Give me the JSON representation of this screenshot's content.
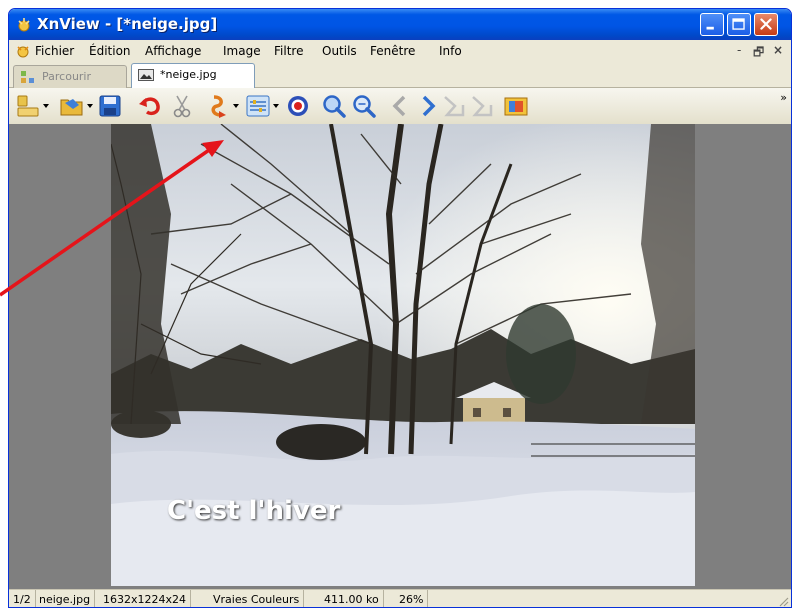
{
  "window": {
    "title": "XnView - [*neige.jpg]",
    "app_icon": "xnview-icon",
    "controls": [
      "minimize-icon",
      "maximize-icon",
      "close-icon"
    ]
  },
  "menubar": {
    "items": [
      {
        "label": "Fichier",
        "name": "menu-fichier"
      },
      {
        "label": "Édition",
        "name": "menu-edition"
      },
      {
        "label": "Affichage",
        "name": "menu-affichage"
      },
      {
        "label": "Image",
        "name": "menu-image"
      },
      {
        "label": "Filtre",
        "name": "menu-filtre"
      },
      {
        "label": "Outils",
        "name": "menu-outils"
      },
      {
        "label": "Fenêtre",
        "name": "menu-fenetre"
      },
      {
        "label": "Info",
        "name": "menu-info"
      }
    ],
    "doc_controls": {
      "minimize": "-",
      "restore": "🗗",
      "close": "×"
    }
  },
  "tabs": [
    {
      "label": "Parcourir",
      "active": false,
      "icon": "browser-icon"
    },
    {
      "label": "*neige.jpg",
      "active": true,
      "icon": "image-thumb-icon"
    }
  ],
  "toolbar": {
    "icons": [
      "browse-folders-icon",
      "open-icon",
      "save-icon",
      "undo-icon",
      "cut-icon",
      "rotate-icon",
      "adjust-icon",
      "color-icon",
      "zoom-in-icon",
      "zoom-out-icon",
      "previous-icon",
      "next-icon",
      "first-icon",
      "last-icon",
      "slideshow-icon"
    ],
    "overflow": "»"
  },
  "image": {
    "caption": "C'est l'hiver"
  },
  "statusbar": {
    "position": "1/2",
    "filename": "neige.jpg",
    "dimensions": "1632x1224x24",
    "color_mode": "Vraies Couleurs",
    "file_size": "411.00 ko",
    "zoom": "26%"
  },
  "colors": {
    "titlebar": "#0055e5",
    "chrome": "#ece9d8",
    "annotation_arrow": "#e5141a",
    "viewer_background": "#7f7f7f"
  }
}
